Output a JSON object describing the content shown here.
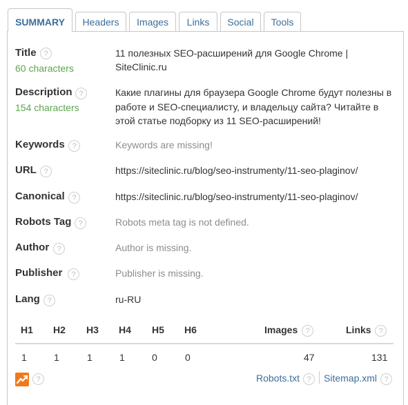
{
  "tabs": [
    {
      "label": "SUMMARY"
    },
    {
      "label": "Headers"
    },
    {
      "label": "Images"
    },
    {
      "label": "Links"
    },
    {
      "label": "Social"
    },
    {
      "label": "Tools"
    }
  ],
  "summary": {
    "title": {
      "label": "Title",
      "count": "60 characters",
      "value_line1": "11 полезных SEO-расширений для Google Chrome |",
      "value_line2": "SiteClinic.ru"
    },
    "description": {
      "label": "Description",
      "count": "154 characters",
      "value_line1": "Какие плагины для браузера Google Chrome будут полезны в",
      "value_line2": "работе и SEO-специалисту, и владельцу сайта? Читайте в",
      "value_line3": "этой статье подборку из 11 SEO-расширений!"
    },
    "keywords": {
      "label": "Keywords",
      "value": "Keywords are missing!"
    },
    "url": {
      "label": "URL",
      "value": "https://siteclinic.ru/blog/seo-instrumenty/11-seo-plaginov/"
    },
    "canonical": {
      "label": "Canonical",
      "value": "https://siteclinic.ru/blog/seo-instrumenty/11-seo-plaginov/"
    },
    "robots_tag": {
      "label": "Robots Tag",
      "value": "Robots meta tag is not defined."
    },
    "author": {
      "label": "Author",
      "value": "Author is missing."
    },
    "publisher": {
      "label": "Publisher",
      "value": "Publisher is missing."
    },
    "lang": {
      "label": "Lang",
      "value": "ru-RU"
    }
  },
  "stats": {
    "headers": [
      "H1",
      "H2",
      "H3",
      "H4",
      "H5",
      "H6"
    ],
    "header_values": [
      "1",
      "1",
      "1",
      "1",
      "0",
      "0"
    ],
    "images_label": "Images",
    "images_value": "47",
    "links_label": "Links",
    "links_value": "131"
  },
  "footer": {
    "robots_link": "Robots.txt",
    "sitemap_link": "Sitemap.xml"
  },
  "help_glyph": "?",
  "colors": {
    "accent": "#3c6e9c",
    "count_green": "#5aa64b",
    "muted": "#8c8c8c",
    "chart_orange": "#f07a1b"
  }
}
